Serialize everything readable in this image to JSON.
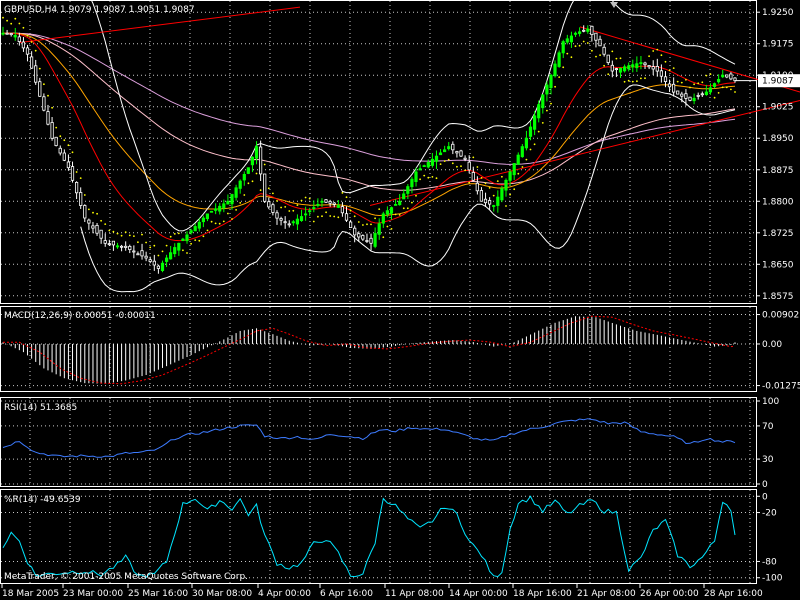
{
  "window": {
    "symbol_title": "GBPUSD,H4  1.9079 1.9087 1.9051 1.9087",
    "copyright": "MetaTrader, © 2001-2005 MetaQuotes Software Corp.",
    "current_price_label": "1.9087"
  },
  "colors": {
    "background": "#000000",
    "grid": "#c8c8c8",
    "frame": "#ffffff",
    "candle_up": "#00ff00",
    "candle_down": "#ffffff",
    "ma_fast": "#ff0000",
    "ma_mid": "#ffa500",
    "ma_slow": "#ffc0cb",
    "ma_long": "#dda0dd",
    "bollinger": "#ffffff",
    "parabolic_sar": "#ffff00",
    "trendline": "#ff0000",
    "macd_hist": "#ffffff",
    "macd_signal": "#ff0000",
    "rsi_line": "#3d7bff",
    "wpr_line": "#00e5ff"
  },
  "chart_data": [
    {
      "name": "price",
      "type": "candlestick",
      "title": "GBPUSD,H4  1.9079 1.9087 1.9051 1.9087",
      "ylim": [
        1.8565,
        1.926
      ],
      "y_ticks": [
        "1.9250",
        "1.9175",
        "1.9100",
        "1.9025",
        "1.8950",
        "1.8875",
        "1.8800",
        "1.8725",
        "1.8650",
        "1.8575"
      ],
      "x_ticks": [
        "18 Mar 2005",
        "23 Mar 00:00",
        "25 Mar 16:00",
        "30 Mar 08:00",
        "4 Apr 00:00",
        "6 Apr 16:00",
        "11 Apr 08:00",
        "14 Apr 00:00",
        "18 Apr 16:00",
        "21 Apr 08:00",
        "26 Apr 00:00",
        "28 Apr 16:00"
      ],
      "last_price": 1.9087,
      "close_keypoints": [
        [
          0,
          1.92
        ],
        [
          3,
          1.9195
        ],
        [
          6,
          1.915
        ],
        [
          9,
          1.905
        ],
        [
          12,
          1.895
        ],
        [
          16,
          1.888
        ],
        [
          20,
          1.876
        ],
        [
          25,
          1.87
        ],
        [
          30,
          1.869
        ],
        [
          35,
          1.8665
        ],
        [
          38,
          1.864
        ],
        [
          42,
          1.869
        ],
        [
          46,
          1.873
        ],
        [
          50,
          1.877
        ],
        [
          55,
          1.88
        ],
        [
          60,
          1.888
        ],
        [
          62,
          1.893
        ],
        [
          64,
          1.88
        ],
        [
          67,
          1.876
        ],
        [
          70,
          1.8745
        ],
        [
          74,
          1.877
        ],
        [
          78,
          1.88
        ],
        [
          82,
          1.879
        ],
        [
          86,
          1.872
        ],
        [
          90,
          1.87
        ],
        [
          93,
          1.877
        ],
        [
          97,
          1.88
        ],
        [
          101,
          1.887
        ],
        [
          105,
          1.89
        ],
        [
          109,
          1.893
        ],
        [
          113,
          1.89
        ],
        [
          117,
          1.88
        ],
        [
          120,
          1.879
        ],
        [
          124,
          1.887
        ],
        [
          128,
          1.895
        ],
        [
          131,
          1.903
        ],
        [
          134,
          1.91
        ],
        [
          137,
          1.918
        ],
        [
          140,
          1.92
        ],
        [
          143,
          1.921
        ],
        [
          146,
          1.917
        ],
        [
          149,
          1.911
        ],
        [
          152,
          1.912
        ],
        [
          156,
          1.913
        ],
        [
          160,
          1.911
        ],
        [
          164,
          1.906
        ],
        [
          168,
          1.904
        ],
        [
          172,
          1.906
        ],
        [
          176,
          1.91
        ],
        [
          179,
          1.9087
        ]
      ]
    },
    {
      "name": "macd",
      "type": "histogram",
      "title": "MACD(12,26,9) 0.00051 -0.00011",
      "ylim": [
        -0.0138,
        0.0098
      ],
      "y_ticks": [
        "0.00902",
        "0.00",
        "-0.01275"
      ],
      "hist_keypoints": [
        [
          0,
          0.0005
        ],
        [
          5,
          -0.0025
        ],
        [
          10,
          -0.0075
        ],
        [
          15,
          -0.0105
        ],
        [
          20,
          -0.012
        ],
        [
          25,
          -0.0122
        ],
        [
          30,
          -0.0112
        ],
        [
          35,
          -0.0095
        ],
        [
          40,
          -0.0068
        ],
        [
          45,
          -0.004
        ],
        [
          50,
          -0.001
        ],
        [
          55,
          0.002
        ],
        [
          58,
          0.004
        ],
        [
          62,
          0.0048
        ],
        [
          66,
          0.003
        ],
        [
          70,
          0.001
        ],
        [
          75,
          -0.0005
        ],
        [
          80,
          0.0
        ],
        [
          85,
          -0.0012
        ],
        [
          90,
          -0.0015
        ],
        [
          95,
          -0.0008
        ],
        [
          100,
          0.0002
        ],
        [
          105,
          0.0008
        ],
        [
          110,
          0.0012
        ],
        [
          115,
          0.0006
        ],
        [
          120,
          -0.0008
        ],
        [
          125,
          0.0005
        ],
        [
          130,
          0.0035
        ],
        [
          135,
          0.0065
        ],
        [
          140,
          0.0085
        ],
        [
          145,
          0.0082
        ],
        [
          150,
          0.006
        ],
        [
          155,
          0.004
        ],
        [
          160,
          0.0028
        ],
        [
          165,
          0.0015
        ],
        [
          170,
          0.0002
        ],
        [
          174,
          -0.0008
        ],
        [
          178,
          -0.0003
        ],
        [
          179,
          0.0005
        ]
      ],
      "signal_lag": 4
    },
    {
      "name": "rsi",
      "type": "line",
      "title": "RSI(14) 51.3685",
      "ylim": [
        0,
        100
      ],
      "y_ticks": [
        "100",
        "70",
        "30",
        "0"
      ],
      "keypoints": [
        [
          0,
          44
        ],
        [
          4,
          52
        ],
        [
          8,
          38
        ],
        [
          14,
          33
        ],
        [
          20,
          34
        ],
        [
          26,
          33
        ],
        [
          30,
          37
        ],
        [
          34,
          38
        ],
        [
          38,
          42
        ],
        [
          42,
          55
        ],
        [
          46,
          60
        ],
        [
          50,
          63
        ],
        [
          54,
          67
        ],
        [
          58,
          70
        ],
        [
          62,
          71
        ],
        [
          64,
          58
        ],
        [
          68,
          55
        ],
        [
          72,
          57
        ],
        [
          76,
          53
        ],
        [
          80,
          60
        ],
        [
          84,
          58
        ],
        [
          88,
          55
        ],
        [
          92,
          65
        ],
        [
          96,
          64
        ],
        [
          100,
          68
        ],
        [
          104,
          66
        ],
        [
          108,
          66
        ],
        [
          112,
          60
        ],
        [
          116,
          54
        ],
        [
          120,
          52
        ],
        [
          124,
          60
        ],
        [
          128,
          65
        ],
        [
          132,
          69
        ],
        [
          136,
          74
        ],
        [
          140,
          77
        ],
        [
          144,
          78
        ],
        [
          148,
          73
        ],
        [
          152,
          74
        ],
        [
          156,
          63
        ],
        [
          160,
          60
        ],
        [
          164,
          57
        ],
        [
          168,
          48
        ],
        [
          172,
          55
        ],
        [
          176,
          51
        ],
        [
          179,
          51
        ]
      ]
    },
    {
      "name": "wpr",
      "type": "line",
      "title": "%R(14) -49.6539",
      "ylim": [
        -104,
        4
      ],
      "y_ticks": [
        "0",
        "-20",
        "-80",
        "-100"
      ],
      "keypoints": [
        [
          0,
          -62
        ],
        [
          2,
          -45
        ],
        [
          4,
          -55
        ],
        [
          6,
          -80
        ],
        [
          8,
          -97
        ],
        [
          12,
          -95
        ],
        [
          16,
          -93
        ],
        [
          20,
          -92
        ],
        [
          24,
          -96
        ],
        [
          28,
          -84
        ],
        [
          30,
          -75
        ],
        [
          33,
          -98
        ],
        [
          37,
          -96
        ],
        [
          40,
          -80
        ],
        [
          42,
          -45
        ],
        [
          44,
          -10
        ],
        [
          47,
          -2
        ],
        [
          50,
          -18
        ],
        [
          53,
          -5
        ],
        [
          56,
          -15
        ],
        [
          58,
          -4
        ],
        [
          60,
          -22
        ],
        [
          62,
          -12
        ],
        [
          64,
          -48
        ],
        [
          67,
          -82
        ],
        [
          70,
          -88
        ],
        [
          73,
          -82
        ],
        [
          76,
          -58
        ],
        [
          79,
          -52
        ],
        [
          82,
          -70
        ],
        [
          85,
          -98
        ],
        [
          88,
          -95
        ],
        [
          91,
          -56
        ],
        [
          93,
          -2
        ],
        [
          96,
          -12
        ],
        [
          99,
          -28
        ],
        [
          102,
          -40
        ],
        [
          105,
          -30
        ],
        [
          108,
          -12
        ],
        [
          111,
          -22
        ],
        [
          114,
          -55
        ],
        [
          117,
          -72
        ],
        [
          120,
          -100
        ],
        [
          122,
          -92
        ],
        [
          124,
          -40
        ],
        [
          126,
          -8
        ],
        [
          129,
          -2
        ],
        [
          132,
          -18
        ],
        [
          135,
          -6
        ],
        [
          138,
          -22
        ],
        [
          141,
          -12
        ],
        [
          144,
          -5
        ],
        [
          147,
          -18
        ],
        [
          150,
          -20
        ],
        [
          153,
          -90
        ],
        [
          156,
          -76
        ],
        [
          159,
          -42
        ],
        [
          162,
          -30
        ],
        [
          165,
          -72
        ],
        [
          168,
          -86
        ],
        [
          171,
          -75
        ],
        [
          174,
          -55
        ],
        [
          176,
          -5
        ],
        [
          178,
          -15
        ],
        [
          179,
          -48
        ]
      ]
    }
  ]
}
